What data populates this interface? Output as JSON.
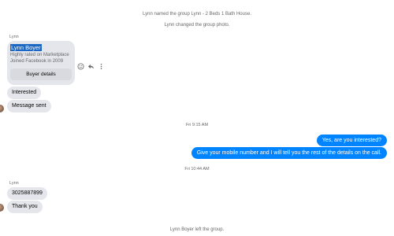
{
  "system_messages": {
    "renamed": "Lynn named the group Lynn - 2 Beds 1 Bath House.",
    "photo_changed": "Lynn changed the group photo.",
    "left_group": "Lynn Boyer left the group."
  },
  "marketplace_card": {
    "sender": "Lynn",
    "name": "Lynn Boyer",
    "line1": "Highly rated on Marketplace",
    "line2": "Joined Facebook in 2009",
    "button": "Buyer details"
  },
  "messages_block1": [
    "Interested",
    "Message sent"
  ],
  "timestamp1": "Fri 9:15 AM",
  "outgoing": [
    "Yes, are you interested?",
    "Give your mobile number and I will tell you the rest of the details on the call."
  ],
  "timestamp2": "Fri 10:44 AM",
  "block2": {
    "sender": "Lynn",
    "messages": [
      "3025887899",
      "Thank you"
    ]
  },
  "icons": [
    "emoji-icon",
    "reply-icon",
    "more-icon"
  ],
  "colors": {
    "outgoing_bubble": "#0084ff",
    "incoming_bubble": "#e4e6eb",
    "meta_text": "#65676b"
  }
}
